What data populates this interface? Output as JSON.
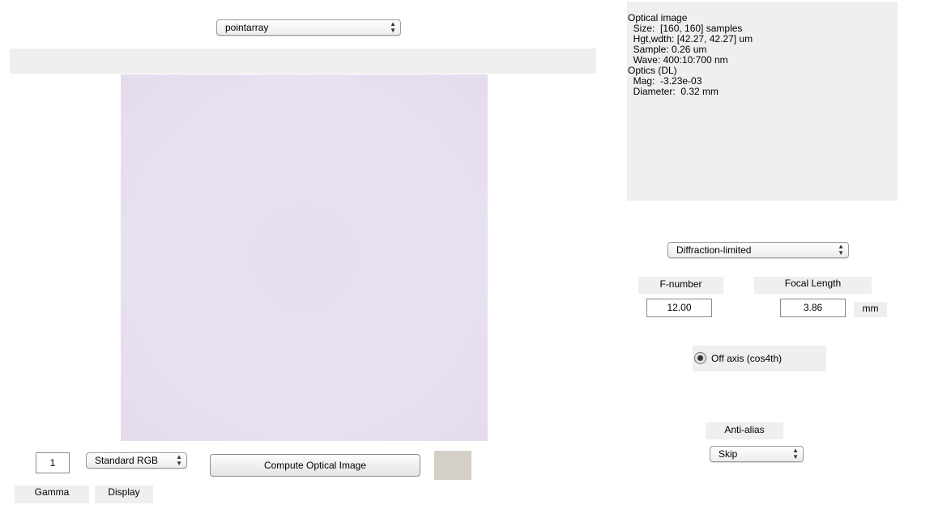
{
  "top": {
    "scene_select": "pointarray"
  },
  "info": {
    "lines": [
      "Optical image",
      "  Size:  [160, 160] samples",
      "  Hgt,wdth: [42.27, 42.27] um",
      "  Sample: 0.26 um",
      "  Wave: 400:10:700 nm",
      "Optics (DL)",
      "  Mag:  -3.23e-03",
      "  Diameter:  0.32 mm"
    ]
  },
  "optics": {
    "model_select": "Diffraction-limited",
    "fnumber_label": "F-number",
    "fnumber_value": "12.00",
    "focal_label": "Focal Length",
    "focal_value": "3.86",
    "focal_unit": "mm",
    "offaxis_label": "Off axis (cos4th)",
    "antialias_label": "Anti-alias",
    "antialias_select": "Skip"
  },
  "bottom": {
    "gamma_value": "1",
    "gamma_label": "Gamma",
    "display_select": "Standard RGB",
    "display_label": "Display",
    "compute_label": "Compute Optical Image"
  },
  "colors": {
    "panel": "#efefef",
    "image_tint": "#e6def0",
    "swatch": "#d4d0c8"
  }
}
